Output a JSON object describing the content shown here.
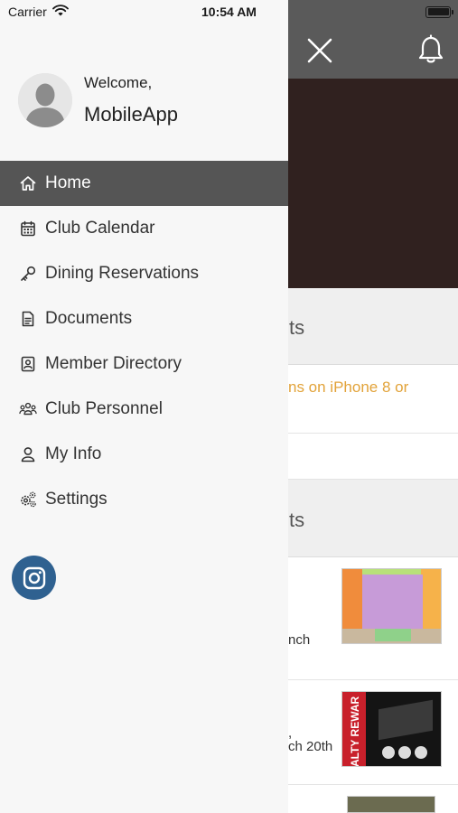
{
  "status_bar": {
    "carrier": "Carrier",
    "time": "10:54 AM"
  },
  "drawer": {
    "welcome": "Welcome,",
    "username": "MobileApp",
    "menu": [
      {
        "label": "Home",
        "icon": "home-icon",
        "active": true
      },
      {
        "label": "Club Calendar",
        "icon": "calendar-icon",
        "active": false
      },
      {
        "label": "Dining Reservations",
        "icon": "key-icon",
        "active": false
      },
      {
        "label": "Documents",
        "icon": "document-icon",
        "active": false
      },
      {
        "label": "Member Directory",
        "icon": "contact-card-icon",
        "active": false
      },
      {
        "label": "Club Personnel",
        "icon": "group-icon",
        "active": false
      },
      {
        "label": "My Info",
        "icon": "user-icon",
        "active": false
      },
      {
        "label": "Settings",
        "icon": "gears-icon",
        "active": false
      }
    ],
    "social_icon": "instagram-icon"
  },
  "background": {
    "section1_title_fragment": "ts",
    "alert_fragment": "ns on iPhone 8 or",
    "section2_title_fragment": "ts",
    "card1_fragment": "nch",
    "card2_line1_fragment": ",",
    "card2_line2_fragment": "ch 20th",
    "thumb2_text": "ALTY REWAR"
  },
  "colors": {
    "active_item_bg": "#555555",
    "topbar_bg": "#5a5a5a",
    "hero_bg": "#30211f",
    "alert_text": "#e2a33a",
    "instagram_bg": "#2f6190",
    "drawer_bg": "#f7f7f7"
  }
}
